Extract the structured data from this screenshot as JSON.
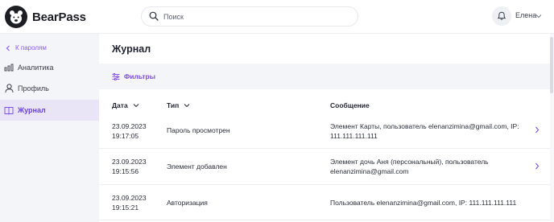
{
  "app": {
    "name": "BearPass"
  },
  "search": {
    "placeholder": "Поиск",
    "value": ""
  },
  "user": {
    "name": "Елена"
  },
  "sidebar": {
    "back_label": "К паролям",
    "items": [
      {
        "label": "Аналитика",
        "icon": "analytics-icon",
        "active": false
      },
      {
        "label": "Профиль",
        "icon": "user-icon",
        "active": false
      },
      {
        "label": "Журнал",
        "icon": "book-icon",
        "active": true
      }
    ]
  },
  "main": {
    "title": "Журнал",
    "filters_label": "Фильтры",
    "columns": {
      "date": "Дата",
      "type": "Тип",
      "message": "Сообщение"
    },
    "rows": [
      {
        "date": "23.09.2023",
        "time": "19:17:05",
        "type": "Пароль просмотрен",
        "message_line1": "Элемент Карты, пользователь elenanzimina@gmail.com, IP:",
        "message_line2": "111.111.111.111",
        "has_details": true
      },
      {
        "date": "23.09.2023",
        "time": "19:15:56",
        "type": "Элемент добавлен",
        "message_line1": "Элемент дочь Аня (персональный), пользователь",
        "message_line2": "elenanzimina@gmail.com",
        "has_details": true
      },
      {
        "date": "23.09.2023",
        "time": "19:15:21",
        "type": "Авторизация",
        "message_line1": "Пользователь elenanzimina@gmail.com, IP: 111.111.111.111",
        "message_line2": "",
        "has_details": false
      }
    ]
  },
  "colors": {
    "accent": "#7c4ce8",
    "sidebar_bg": "#f4f5f8",
    "active_bg": "#e9e5f6"
  }
}
